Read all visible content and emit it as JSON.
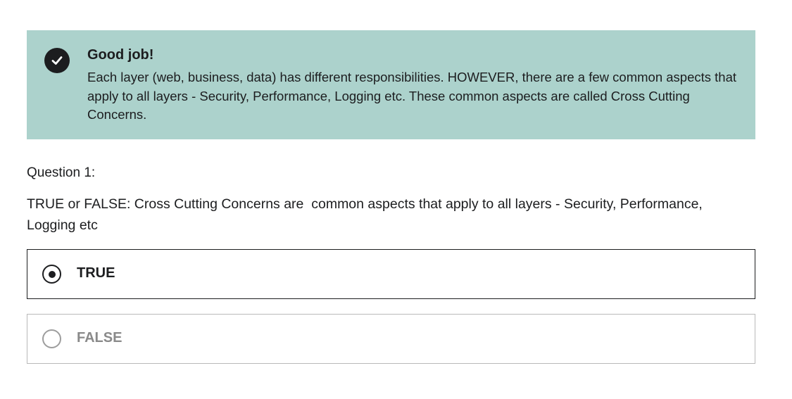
{
  "feedback": {
    "title": "Good job!",
    "message": "Each layer (web, business, data) has different responsibilities. HOWEVER, there are a few common aspects that apply to all layers - Security, Performance, Logging etc. These common aspects are called Cross Cutting Concerns.",
    "icon": "checkmark-circle-icon",
    "background_color": "#acd2cc"
  },
  "question": {
    "number_label": "Question 1:",
    "text": "TRUE or FALSE: Cross Cutting Concerns are  common aspects that apply to all layers - Security, Performance, Logging etc"
  },
  "options": [
    {
      "label": "TRUE",
      "selected": true
    },
    {
      "label": "FALSE",
      "selected": false
    }
  ]
}
